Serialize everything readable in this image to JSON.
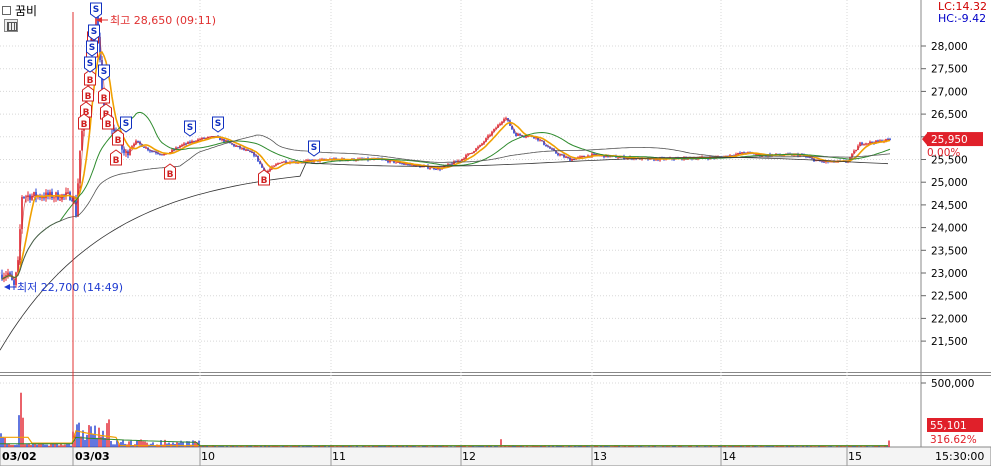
{
  "stock": {
    "name": "꿈비"
  },
  "corner": {
    "lc": "LC:14.32",
    "hc": "HC:-9.42"
  },
  "annotations": {
    "high": "최고 28,650 (09:11)",
    "low": "최저 22,700 (14:49)"
  },
  "price_axis": [
    "28,000",
    "27,500",
    "27,000",
    "26,500",
    "26,000",
    "25,500",
    "25,000",
    "24,500",
    "24,000",
    "23,500",
    "23,000",
    "22,500",
    "22,000",
    "21,500"
  ],
  "current": {
    "price": "25,950",
    "pct": "0.00%"
  },
  "volume_axis": {
    "top": "500,000",
    "current": "55,101",
    "pct": "316.62%"
  },
  "date_labels": [
    {
      "text": "03/02",
      "bold": true
    },
    {
      "text": "03/03",
      "bold": true
    },
    {
      "text": "10",
      "bold": false
    },
    {
      "text": "11",
      "bold": false
    },
    {
      "text": "12",
      "bold": false
    },
    {
      "text": "13",
      "bold": false
    },
    {
      "text": "14",
      "bold": false
    },
    {
      "text": "15",
      "bold": false
    }
  ],
  "time_label": "15:30:00",
  "signals": {
    "buy": "B",
    "sell": "S"
  },
  "colors": {
    "up": "#e0202a",
    "down": "#1f3bd1",
    "ma_short": "#f0a000",
    "ma_mid": "#2e8b2e",
    "ma_long": "#555555",
    "grid": "#d8d8d8",
    "cursor": "#e03030"
  }
}
